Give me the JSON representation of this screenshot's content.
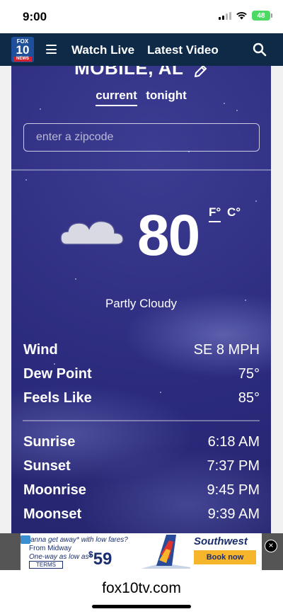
{
  "status_bar": {
    "time": "9:00",
    "battery": "48",
    "icons": [
      "signal-icon",
      "wifi-icon",
      "battery-icon"
    ]
  },
  "nav": {
    "logo": {
      "line1": "FOX",
      "line2": "10",
      "line3": "NEWS"
    },
    "menu_icon": "hamburger-icon",
    "watch_live": "Watch Live",
    "latest_video": "Latest Video",
    "search_icon": "search-icon",
    "background": "#0e2a47"
  },
  "weather": {
    "city": "MOBILE, AL",
    "edit_icon": "pencil-icon",
    "tabs": [
      {
        "label": "current",
        "active": true
      },
      {
        "label": "tonight",
        "active": false
      }
    ],
    "zip_placeholder": "enter a zipcode",
    "condition_icon": "partly-cloudy-night-icon",
    "temperature": "80",
    "unit_f": "F°",
    "unit_c": "C°",
    "active_unit": "F",
    "condition": "Partly Cloudy",
    "stats": [
      {
        "label": "Wind",
        "value": "SE 8 MPH"
      },
      {
        "label": "Dew Point",
        "value": "75°"
      },
      {
        "label": "Feels Like",
        "value": "85°"
      }
    ],
    "astro": [
      {
        "label": "Sunrise",
        "value": "6:18 AM"
      },
      {
        "label": "Sunset",
        "value": "7:37 PM"
      },
      {
        "label": "Moonrise",
        "value": "9:45 PM"
      },
      {
        "label": "Moonset",
        "value": "9:39 AM"
      }
    ],
    "background": "#2b2a7c"
  },
  "ad": {
    "headline": "anna get away* with low fares?",
    "from": "From Midway",
    "oneway": "One-way as low as*",
    "price": "59",
    "currency": "$",
    "terms": "TERMS",
    "brand": "Southwest",
    "cta": "Book now",
    "close_icon": "close-icon"
  },
  "browser": {
    "url": "fox10tv.com"
  }
}
